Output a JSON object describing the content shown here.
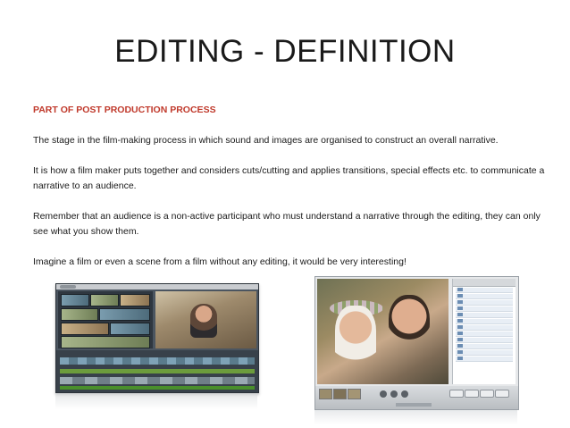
{
  "slide": {
    "title": "EDITING - DEFINITION",
    "subheading": "PART OF POST PRODUCTION PROCESS",
    "paragraphs": [
      "The stage in the film-making process in which sound and images are organised to construct an overall narrative.",
      "It is how a film maker puts together and considers cuts/cutting and applies transitions, special effects etc. to communicate a narrative to an audience.",
      "Remember that an audience is a non-active participant who must understand a narrative through the editing, they can only see what you show them.",
      "Imagine a film or even a scene from a film without any editing, it would be very interesting!"
    ]
  },
  "colors": {
    "subheading": "#c0392b",
    "text": "#1a1a1a",
    "background": "#ffffff"
  },
  "images": {
    "left": "video-editing-software-screenshot",
    "right": "photo-slideshow-editing-screenshot"
  }
}
